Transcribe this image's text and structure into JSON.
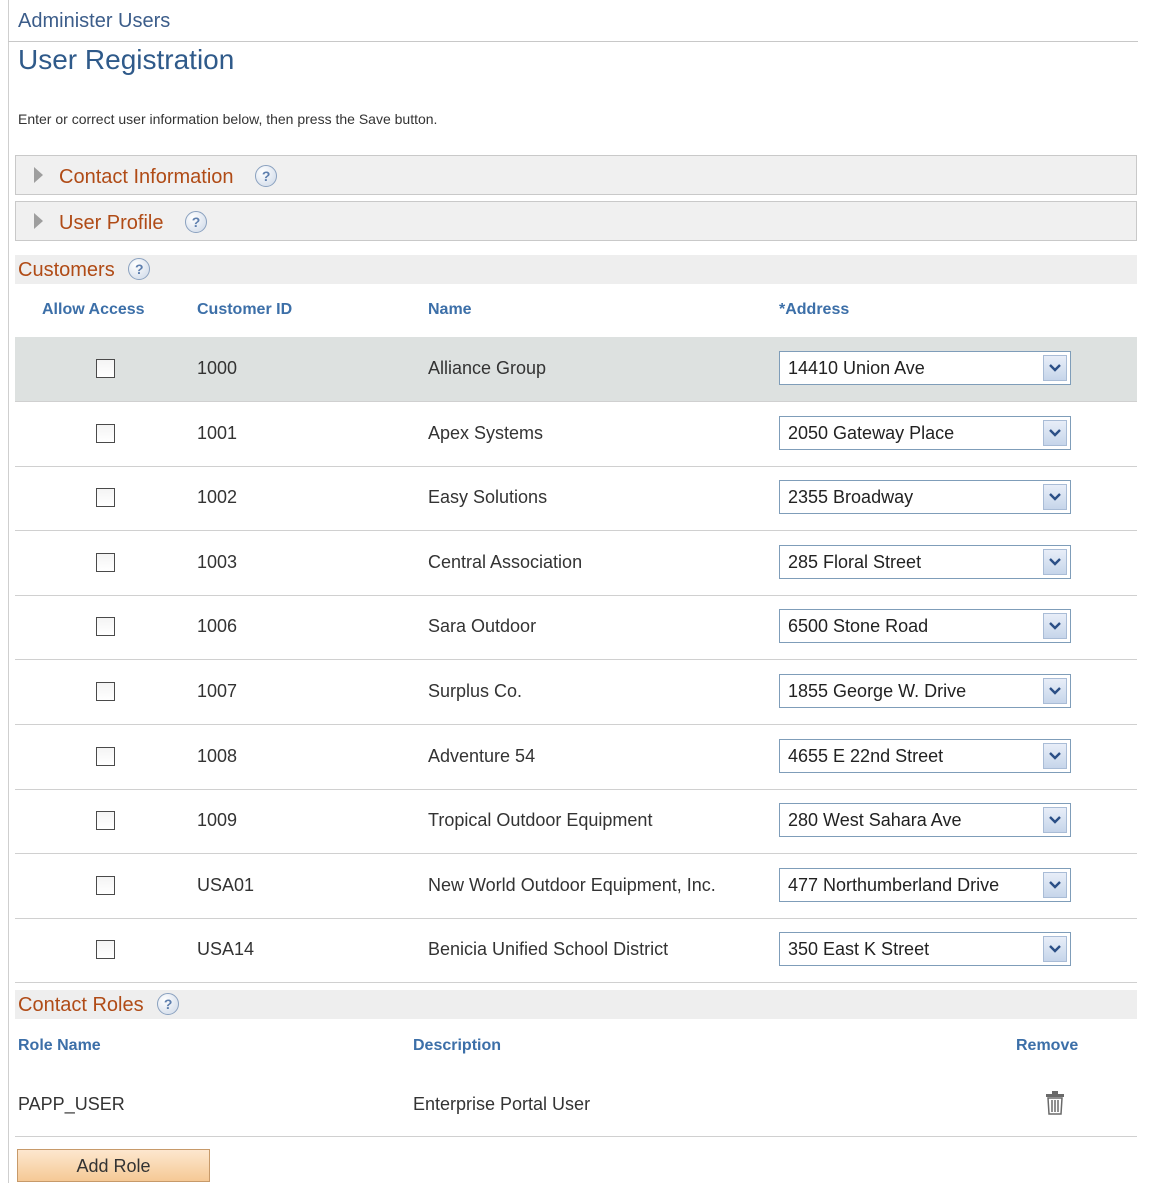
{
  "breadcrumb": "Administer Users",
  "page_title": "User Registration",
  "instructions": "Enter or correct user information below, then press the Save button.",
  "sections": {
    "contact_information": "Contact Information",
    "user_profile": "User Profile",
    "customers": "Customers",
    "contact_roles": "Contact Roles"
  },
  "customers_table": {
    "columns": {
      "allow_access": "Allow Access",
      "customer_id": "Customer ID",
      "name": "Name",
      "address": "*Address"
    },
    "rows": [
      {
        "id": "1000",
        "name": "Alliance Group",
        "address": "14410 Union Ave",
        "allow": false,
        "selected": true
      },
      {
        "id": "1001",
        "name": "Apex Systems",
        "address": "2050 Gateway Place",
        "allow": false,
        "selected": false
      },
      {
        "id": "1002",
        "name": "Easy Solutions",
        "address": "2355 Broadway",
        "allow": false,
        "selected": false
      },
      {
        "id": "1003",
        "name": "Central Association",
        "address": "285 Floral Street",
        "allow": false,
        "selected": false
      },
      {
        "id": "1006",
        "name": "Sara Outdoor",
        "address": "6500 Stone Road",
        "allow": false,
        "selected": false
      },
      {
        "id": "1007",
        "name": "Surplus Co.",
        "address": "1855 George W. Drive",
        "allow": false,
        "selected": false
      },
      {
        "id": "1008",
        "name": "Adventure 54",
        "address": "4655 E 22nd Street",
        "allow": false,
        "selected": false
      },
      {
        "id": "1009",
        "name": "Tropical Outdoor Equipment",
        "address": "280 West Sahara Ave",
        "allow": false,
        "selected": false
      },
      {
        "id": "USA01",
        "name": "New World Outdoor Equipment, Inc.",
        "address": "477 Northumberland Drive",
        "allow": false,
        "selected": false
      },
      {
        "id": "USA14",
        "name": "Benicia Unified School District",
        "address": "350 East K Street",
        "allow": false,
        "selected": false
      }
    ]
  },
  "roles_table": {
    "columns": {
      "role_name": "Role Name",
      "description": "Description",
      "remove": "Remove"
    },
    "rows": [
      {
        "role": "PAPP_USER",
        "description": "Enterprise Portal User"
      }
    ]
  },
  "add_role_button": "Add Role",
  "help_glyph": "?",
  "icons": {
    "expand": "triangle-right-icon",
    "help": "help-icon",
    "dropdown": "chevron-down-icon",
    "remove": "trash-icon"
  },
  "colors": {
    "section_label": "#b04b16",
    "column_header": "#3c6fa8",
    "title": "#2f5a8a",
    "selected_row": "#dde1e0",
    "button_fill": "#f5c995"
  }
}
